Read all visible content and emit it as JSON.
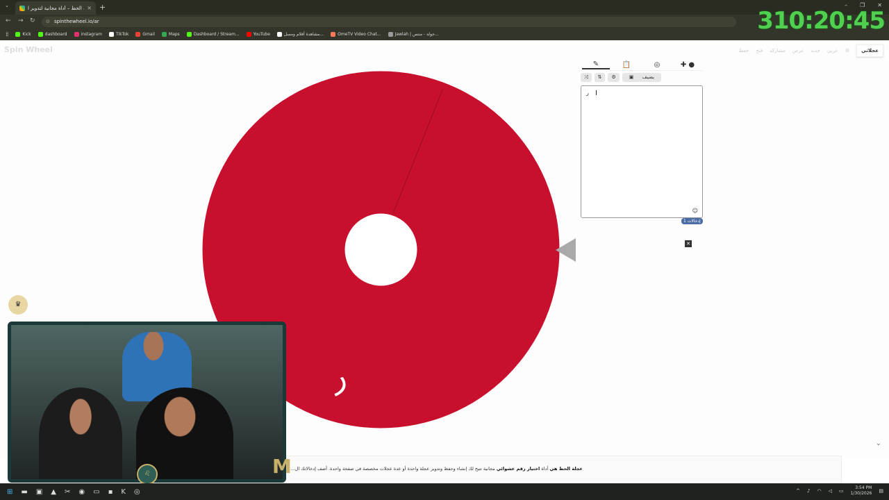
{
  "browser": {
    "tab_title": "عجلة الحظ – أداة مجانية لتدوير ا...",
    "tab_close": "×",
    "new_tab": "+",
    "url": "spinthewheel.io/ar",
    "bookmarks": [
      {
        "label": "Kick",
        "color": "#53fc18"
      },
      {
        "label": "dashboard",
        "color": "#53fc18"
      },
      {
        "label": "instagram",
        "color": "#e1306c"
      },
      {
        "label": "TikTok",
        "color": "#ffffff"
      },
      {
        "label": "Gmail",
        "color": "#ea4335"
      },
      {
        "label": "Maps",
        "color": "#34a853"
      },
      {
        "label": "Dashboard / Stream...",
        "color": "#53fc18"
      },
      {
        "label": "YouTube",
        "color": "#ff0000"
      },
      {
        "label": "مشاهدة أفلام ومسل...",
        "color": "#ffffff"
      },
      {
        "label": "OmeTV Video Chat...",
        "color": "#ff7a59"
      },
      {
        "label": "Jawlah | جولة - منتص...",
        "color": "#999999"
      }
    ]
  },
  "overlay": {
    "timer": "310:20:45"
  },
  "site": {
    "logo": "Spin Wheel",
    "nav": [
      "عجلاتي",
      "عربي",
      "جديد",
      "عرض",
      "مشاركة",
      "فتح",
      "حفظ"
    ],
    "nav_active": "عجلاتي"
  },
  "wheel": {
    "segment_label": "ر",
    "color": "#c8102e"
  },
  "panel": {
    "tools": [
      "تغيير",
      "ترتيب",
      "إعدادات",
      "إضافة صورة"
    ],
    "add_image_label": "يضيف",
    "entries_text": "ر",
    "entry_count_label": "إدخالات 1",
    "emoji_icon": "☺"
  },
  "footer": {
    "bold_prefix": "عجلة الحظ هي",
    "text_1": "أداة",
    "bold_mid": "اختيار رقم عشوائي",
    "text_2": "مجانية تتيح لك إنشاء وحفظ وتدوير عجلة واحدة أو عدة عجلات مخصصة في صفحة واحدة. أضف إدخالاتك ال..."
  },
  "taskbar": {
    "time": "3:54 PM",
    "date": "1/30/2026"
  }
}
